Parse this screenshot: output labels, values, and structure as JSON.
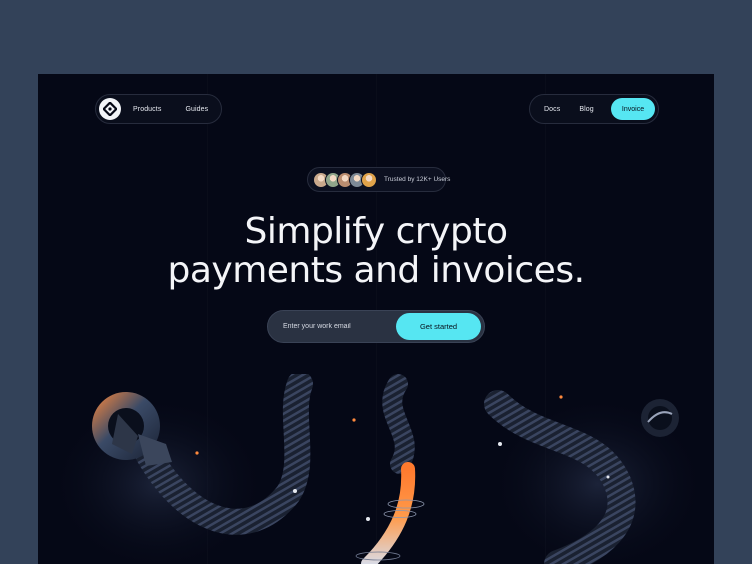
{
  "nav": {
    "left_links": [
      "Products",
      "Guides"
    ],
    "right_links": [
      "Docs",
      "Blog"
    ],
    "cta_label": "Invoice"
  },
  "trust": {
    "text": "Trusted by 12K+ Users",
    "avatar_colors": [
      "#c9a98c",
      "#8fa58a",
      "#b98c6f",
      "#7e8a97",
      "#e0a34a"
    ]
  },
  "hero": {
    "title_line1": "Simplify crypto",
    "title_line2": "payments and invoices."
  },
  "signup": {
    "placeholder": "Enter your work email",
    "button_label": "Get started"
  },
  "colors": {
    "accent": "#56e6f2",
    "background": "#050816",
    "outer": "#334259"
  }
}
